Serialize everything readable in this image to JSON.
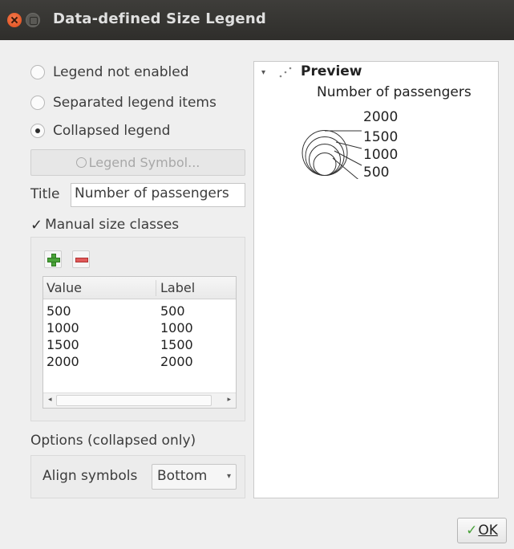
{
  "window": {
    "title": "Data-defined Size Legend"
  },
  "legend_mode": {
    "options": [
      {
        "label": "Legend not enabled",
        "selected": false
      },
      {
        "label": "Separated legend items",
        "selected": false
      },
      {
        "label": "Collapsed legend",
        "selected": true
      }
    ]
  },
  "legend_symbol_button": {
    "label": "Legend Symbol..."
  },
  "title_field": {
    "label": "Title",
    "value": "Number of passengers"
  },
  "manual_classes": {
    "label": "Manual size classes",
    "checked": true
  },
  "classes_table": {
    "columns": [
      "Value",
      "Label"
    ],
    "rows": [
      {
        "value": "500",
        "label": "500"
      },
      {
        "value": "1000",
        "label": "1000"
      },
      {
        "value": "1500",
        "label": "1500"
      },
      {
        "value": "2000",
        "label": "2000"
      }
    ]
  },
  "options": {
    "label": "Options (collapsed only)",
    "align_label": "Align symbols",
    "align_value": "Bottom"
  },
  "preview": {
    "heading": "Preview",
    "legend_title": "Number of passengers",
    "values": [
      "2000",
      "1500",
      "1000",
      "500"
    ]
  },
  "buttons": {
    "ok_label": "OK"
  }
}
